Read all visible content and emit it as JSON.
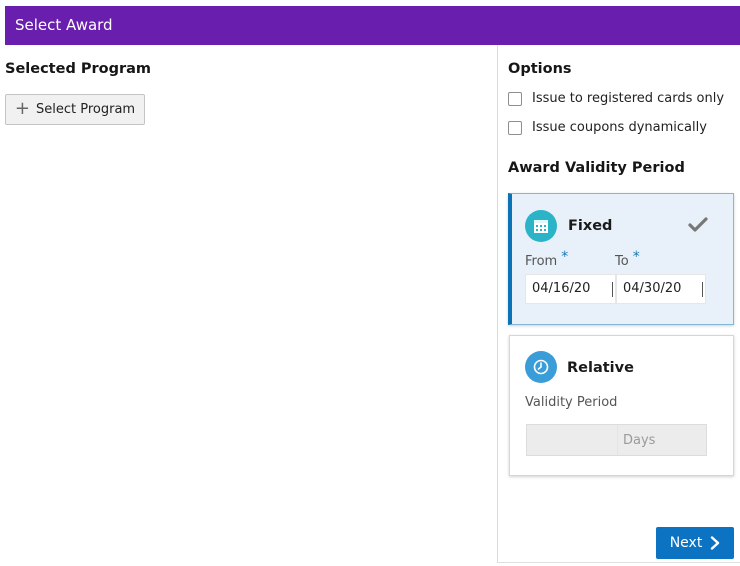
{
  "header": {
    "title": "Select Award"
  },
  "left": {
    "section_title": "Selected Program",
    "select_button_label": "Select Program"
  },
  "options": {
    "title": "Options",
    "checkboxes": [
      {
        "label": "Issue to registered cards only",
        "checked": false
      },
      {
        "label": "Issue coupons dynamically",
        "checked": false
      }
    ]
  },
  "validity": {
    "title": "Award Validity Period",
    "fixed": {
      "title": "Fixed",
      "selected": true,
      "from_label": "From",
      "to_label": "To",
      "required_marker": "*",
      "from_value": "04/16/20",
      "to_value": "04/30/20"
    },
    "relative": {
      "title": "Relative",
      "selected": false,
      "period_label": "Validity Period",
      "period_value": "",
      "unit_label": "Days"
    }
  },
  "footer": {
    "next_label": "Next"
  },
  "colors": {
    "header_bg": "#6a1ead",
    "accent": "#0b73c2",
    "fixed_icon": "#2bb3c7",
    "relative_icon": "#3a9dd8"
  }
}
